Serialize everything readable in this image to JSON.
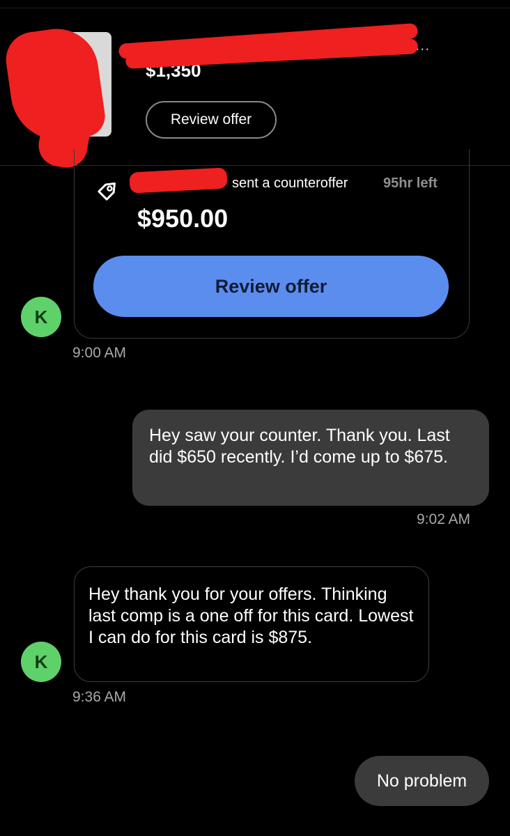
{
  "listing": {
    "price": "$1,350",
    "title_ellipsis": "...",
    "review_button_label": "Review offer"
  },
  "offer_card": {
    "status_text": "sent a counteroffer",
    "time_left": "95hr left",
    "amount": "$950.00",
    "review_button_label": "Review offer"
  },
  "messages": [
    {
      "direction": "incoming",
      "avatar_initial": "K",
      "timestamp": "9:00 AM"
    },
    {
      "direction": "outgoing",
      "text": "Hey saw your counter. Thank you. Last did $650 recently. I’d come up to $675.",
      "timestamp": "9:02 AM"
    },
    {
      "direction": "incoming",
      "avatar_initial": "K",
      "text": "Hey thank you for your offers. Thinking last comp is a one off for this card. Lowest I can do for this card is $875.",
      "timestamp": "9:36 AM"
    },
    {
      "direction": "outgoing",
      "text": "No problem"
    }
  ],
  "colors": {
    "background": "#000000",
    "accent_button": "#5b8def",
    "avatar": "#5fd16a",
    "outgoing_bubble": "#3b3b3b",
    "redaction": "#ee2020"
  },
  "icons": {
    "offer_tag": "price-tag-icon"
  }
}
